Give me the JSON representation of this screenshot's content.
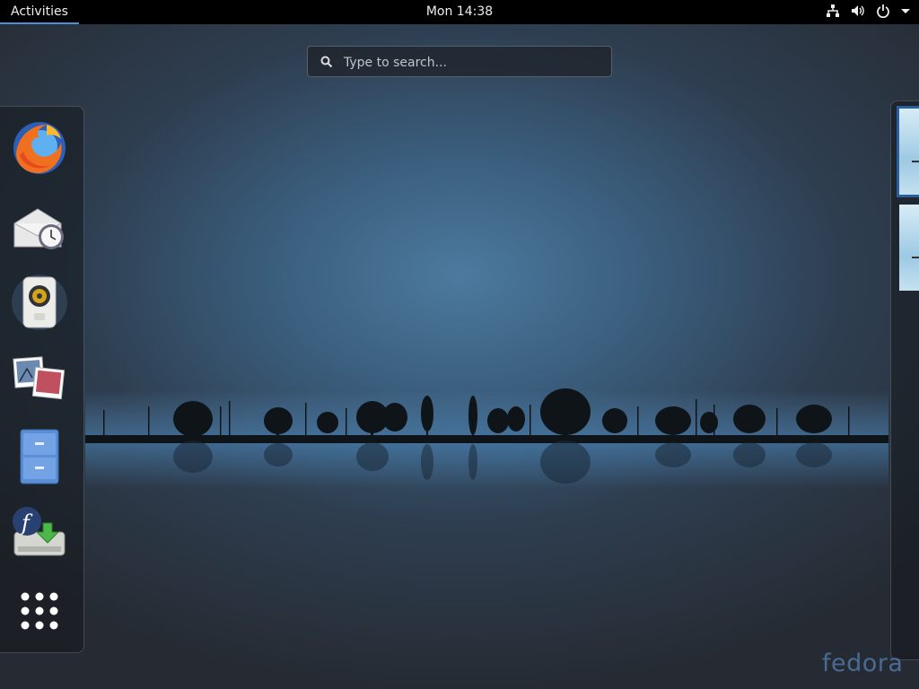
{
  "topbar": {
    "activities_label": "Activities",
    "clock": "Mon 14:38",
    "tray_icons": [
      "network-icon",
      "volume-icon",
      "power-icon",
      "dropdown-arrow-icon"
    ]
  },
  "search": {
    "placeholder": "Type to search..."
  },
  "dash": {
    "apps": [
      {
        "name": "Firefox",
        "icon": "firefox-icon"
      },
      {
        "name": "Evolution",
        "icon": "mail-clock-icon"
      },
      {
        "name": "Rhythmbox",
        "icon": "speaker-icon"
      },
      {
        "name": "Shotwell",
        "icon": "photos-icon"
      },
      {
        "name": "Files",
        "icon": "file-cabinet-icon"
      },
      {
        "name": "Fedora Install",
        "icon": "fedora-install-icon"
      }
    ],
    "show_apps_icon": "grid-icon"
  },
  "workspaces": {
    "count": 2,
    "active": 1
  },
  "watermark": "fedora",
  "colors": {
    "accent": "#4a90d9",
    "topbar": "#000000",
    "active_workspace": "#2a5f9e"
  }
}
